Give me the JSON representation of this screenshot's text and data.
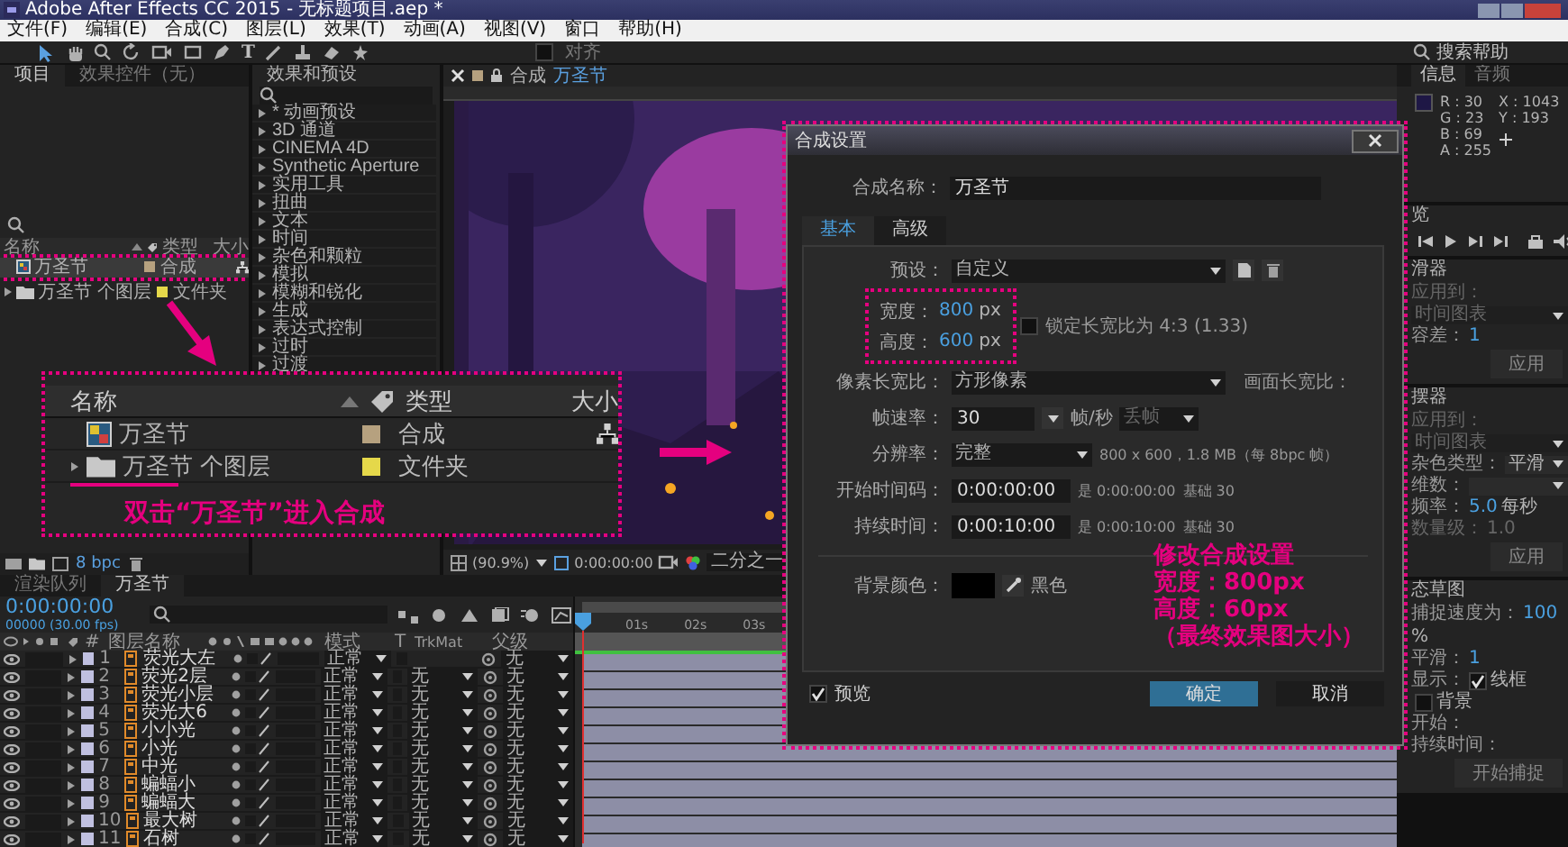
{
  "window": {
    "title": "Adobe After Effects CC 2015 - 无标题项目.aep *"
  },
  "menu": [
    "文件(F)",
    "编辑(E)",
    "合成(C)",
    "图层(L)",
    "效果(T)",
    "动画(A)",
    "视图(V)",
    "窗口",
    "帮助(H)"
  ],
  "toolbar": {
    "text_tool": "T",
    "snap_label": "对齐",
    "snap_checked": false,
    "search_placeholder": "搜索帮助"
  },
  "project_panel": {
    "tabs": [
      {
        "label": "项目",
        "selected": true
      },
      {
        "label": "效果控件（无）",
        "selected": false
      }
    ],
    "columns": [
      "名称",
      "类型",
      "大小"
    ],
    "items": [
      {
        "kind": "comp",
        "name": "万圣节",
        "type": "合成",
        "color": "#b6a17f",
        "selected": true
      },
      {
        "kind": "folder",
        "name": "万圣节 个图层",
        "type": "文件夹",
        "color": "#e5d84a",
        "selected": false
      }
    ],
    "depth_label": "8 bpc"
  },
  "effects_panel": {
    "title": "效果和预设",
    "items": [
      "* 动画预设",
      "3D 通道",
      "CINEMA 4D",
      "Synthetic Aperture",
      "实用工具",
      "扭曲",
      "文本",
      "时间",
      "杂色和颗粒",
      "模拟",
      "模糊和锐化",
      "生成",
      "表达式控制",
      "过时",
      "过渡"
    ]
  },
  "viewer": {
    "tab_label": "合成",
    "comp_name": "万圣节",
    "zoom": "(90.9%)",
    "timecode": "0:00:00:00",
    "resolution": "二分之一"
  },
  "timeline": {
    "tabs": [
      {
        "label": "渲染队列",
        "selected": false
      },
      {
        "label": "万圣节",
        "selected": true
      }
    ],
    "timecode": "0:00:00:00",
    "frame_info": "00000 (30.00 fps)",
    "columns": {
      "number": "#",
      "name": "图层名称",
      "mode": "模式",
      "t": "T",
      "trkmat": "TrkMat",
      "parent": "父级"
    },
    "ruler": [
      "01s",
      "02s",
      "03s"
    ],
    "layers": [
      {
        "number": "1",
        "name": "荧光大左",
        "mode": "正常",
        "parent": "无"
      },
      {
        "number": "2",
        "name": "荧光2层",
        "mode": "正常",
        "trkmat": "无",
        "parent": "无"
      },
      {
        "number": "3",
        "name": "荧光小层",
        "mode": "正常",
        "trkmat": "无",
        "parent": "无"
      },
      {
        "number": "4",
        "name": "荧光大6",
        "mode": "正常",
        "trkmat": "无",
        "parent": "无"
      },
      {
        "number": "5",
        "name": "小小光",
        "mode": "正常",
        "trkmat": "无",
        "parent": "无"
      },
      {
        "number": "6",
        "name": "小光",
        "mode": "正常",
        "trkmat": "无",
        "parent": "无"
      },
      {
        "number": "7",
        "name": "中光",
        "mode": "正常",
        "trkmat": "无",
        "parent": "无"
      },
      {
        "number": "8",
        "name": "蝙蝠小",
        "mode": "正常",
        "trkmat": "无",
        "parent": "无"
      },
      {
        "number": "9",
        "name": "蝙蝠大",
        "mode": "正常",
        "trkmat": "无",
        "parent": "无"
      },
      {
        "number": "10",
        "name": "最大树",
        "mode": "正常",
        "trkmat": "无",
        "parent": "无"
      },
      {
        "number": "11",
        "name": "石树",
        "mode": "正常",
        "trkmat": "无",
        "parent": "无"
      }
    ]
  },
  "info_panel": {
    "tabs": [
      {
        "label": "信息",
        "selected": true
      },
      {
        "label": "音频",
        "selected": false
      }
    ],
    "rgba": [
      "R : 30",
      "G : 23",
      "B : 69",
      "A : 255"
    ],
    "xy": [
      "X : 1043",
      "Y : 193"
    ]
  },
  "right_panels": [
    {
      "kind": "preview",
      "title": "览"
    },
    {
      "kind": "form",
      "title": "滑器",
      "rows": [
        {
          "kind": "dropdown",
          "label": "应用到：",
          "value": "时间图表",
          "disabled": true
        },
        {
          "kind": "number",
          "label": "容差：",
          "value": "1",
          "disabled": false
        }
      ],
      "button": "应用"
    },
    {
      "kind": "form",
      "title": "摆器",
      "rows": [
        {
          "kind": "dropdown",
          "label": "应用到：",
          "value": "时间图表",
          "disabled": true
        },
        {
          "kind": "dropdown",
          "label": "杂色类型：",
          "value": "平滑",
          "disabled": false
        },
        {
          "kind": "dropdown",
          "label": "维数：",
          "disabled": false
        },
        {
          "kind": "number",
          "label": "频率：",
          "value": "5.0",
          "unit": "每秒",
          "disabled": false
        },
        {
          "kind": "number",
          "label": "数量级：",
          "value": "1.0",
          "disabled": true
        }
      ],
      "button": "应用"
    },
    {
      "kind": "form",
      "title": "态草图",
      "rows": [
        {
          "kind": "number",
          "label": "捕捉速度为：",
          "value": "100",
          "unit": "%",
          "disabled": false
        },
        {
          "kind": "number",
          "label": "平滑：",
          "value": "1",
          "disabled": false
        },
        {
          "kind": "check",
          "label": "显示：",
          "value": "线框",
          "checked": true
        },
        {
          "kind": "check",
          "value": "背景",
          "checked": false
        },
        {
          "kind": "text",
          "label": "开始："
        },
        {
          "kind": "text",
          "label": "持续时间："
        }
      ],
      "button": "开始捕捉"
    }
  ],
  "dialog": {
    "title": "合成设置",
    "name_label": "合成名称：",
    "name_value": "万圣节",
    "tabs": [
      {
        "label": "基本",
        "selected": true
      },
      {
        "label": "高级",
        "selected": false
      }
    ],
    "preset_label": "预设：",
    "preset_value": "自定义",
    "width_label": "宽度：",
    "width_value": "800",
    "width_unit": "px",
    "height_label": "高度：",
    "height_value": "600",
    "height_unit": "px",
    "lock_label": "锁定长宽比为 4:3 (1.33)",
    "lock_checked": false,
    "par_label": "像素长宽比：",
    "par_value": "方形像素",
    "frame_aspect_label": "画面长宽比：",
    "fps_label": "帧速率：",
    "fps_value": "30",
    "fps_unit": "帧/秒",
    "drop_frame": {
      "label": "丢帧",
      "disabled": true
    },
    "res_label": "分辨率：",
    "res_value": "完整",
    "res_info": "800 x 600，1.8 MB（每 8bpc 帧）",
    "start_label": "开始时间码：",
    "start_value": "0:00:00:00",
    "start_info": "是 0:00:00:00",
    "start_base": "基础 30",
    "dur_label": "持续时间：",
    "dur_value": "0:00:10:00",
    "dur_info": "是 0:00:10:00",
    "dur_base": "基础 30",
    "bg_label": "背景颜色：",
    "bg_name": "黑色",
    "preview_label": "预览",
    "preview_checked": true,
    "ok": "确定",
    "cancel": "取消"
  },
  "annotation_note": [
    "修改合成设置",
    "宽度：800px",
    "高度：60px",
    "（最终效果图大小）"
  ],
  "callout": {
    "columns": [
      "名称",
      "类型",
      "大小"
    ],
    "items": [
      {
        "kind": "comp",
        "name": "万圣节",
        "type": "合成",
        "color": "#b6a17f"
      },
      {
        "kind": "folder",
        "name": "万圣节 个图层",
        "type": "文件夹",
        "color": "#e5d84a"
      }
    ],
    "caption": "双击“万圣节”进入合成"
  }
}
